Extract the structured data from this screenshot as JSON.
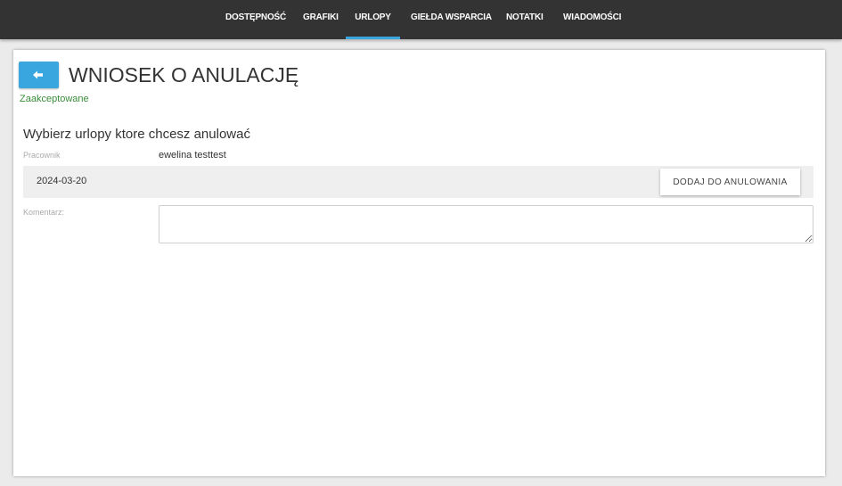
{
  "nav": {
    "items": [
      {
        "label": "DOSTĘPNOŚĆ"
      },
      {
        "label": "GRAFIKI"
      },
      {
        "label": "URLOPY",
        "active": true
      },
      {
        "label": "GIEŁDA WSPARCIA"
      },
      {
        "label": "NOTATKI"
      },
      {
        "label": "WIADOMOŚCI"
      }
    ]
  },
  "page": {
    "back_icon": "arrow-left-icon",
    "title": "WNIOSEK O ANULACJĘ",
    "status": "Zaakceptowane",
    "subtitle": "Wybierz urlopy ktore chcesz anulować"
  },
  "form": {
    "employee_label": "Pracownik",
    "employee_value": "ewelina testtest",
    "leave_rows": [
      {
        "date": "2024-03-20",
        "button_label": "DODAJ DO ANULOWANIA"
      }
    ],
    "comment_label": "Komentarz:",
    "comment_value": ""
  },
  "colors": {
    "nav_bg": "#333333",
    "accent": "#3aa6e0",
    "status_green": "#3a8c3a"
  }
}
